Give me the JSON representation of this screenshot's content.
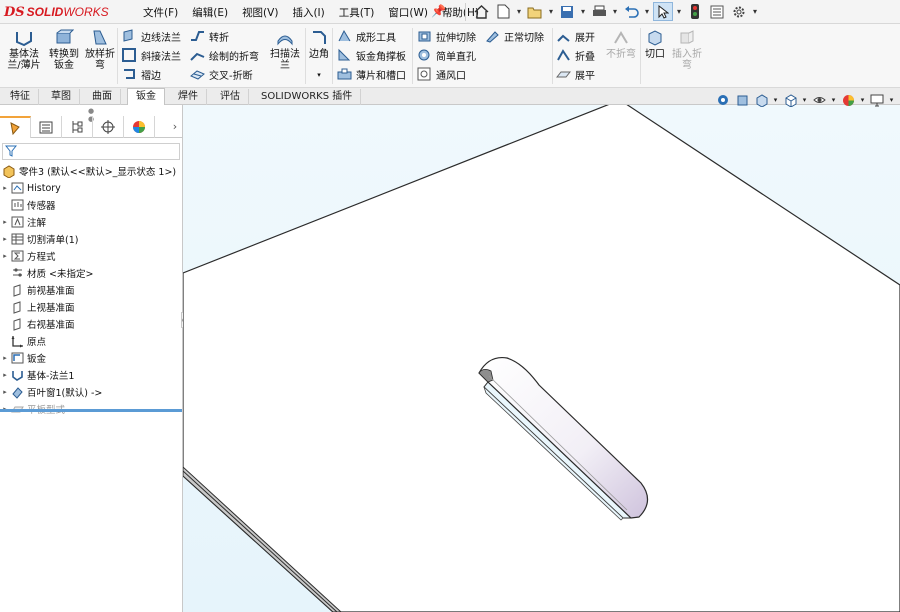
{
  "app": {
    "brand_ds": "DS",
    "brand_solid": "SOLID",
    "brand_works": "WORKS"
  },
  "menu": [
    "文件(F)",
    "编辑(E)",
    "视图(V)",
    "插入(I)",
    "工具(T)",
    "窗口(W)",
    "帮助(H)"
  ],
  "quick_access": [
    "home-icon",
    "new-icon",
    "open-icon",
    "save-icon",
    "print-icon",
    "undo-icon",
    "select-icon",
    "traffic-light-icon",
    "options-icon",
    "settings-icon"
  ],
  "ribbon": {
    "big": [
      {
        "label": "基体法\n兰/薄片",
        "icon": "base-flange-icon"
      },
      {
        "label": "转换到\n钣金",
        "icon": "convert-sheetmetal-icon"
      },
      {
        "label": "放样折\n弯",
        "icon": "lofted-bend-icon"
      }
    ],
    "col1": [
      "边线法兰",
      "斜接法兰",
      "褶边"
    ],
    "col2": [
      "转折",
      "绘制的折弯",
      "交叉-折断"
    ],
    "sweep": "扫描法\n兰",
    "corner": "边角",
    "col3": [
      "成形工具",
      "钣金角撑板",
      "薄片和槽口"
    ],
    "col4": [
      "拉伸切除",
      "简单直孔",
      "通风口"
    ],
    "normal_cut": "正常切除",
    "col5": [
      "展开",
      "折叠",
      "展平"
    ],
    "no_bend": "不折弯",
    "rip": "切口",
    "insert_bend": "插入折\n弯"
  },
  "tabs": [
    "特征",
    "草图",
    "曲面",
    "钣金",
    "焊件",
    "评估",
    "SOLIDWORKS 插件"
  ],
  "active_tab": "钣金",
  "tree": {
    "root": "零件3 (默认<<默认>_显示状态 1>)",
    "items": [
      {
        "label": "History",
        "expandable": true,
        "icon": "history-icon"
      },
      {
        "label": "传感器",
        "expandable": false,
        "icon": "sensor-icon"
      },
      {
        "label": "注解",
        "expandable": true,
        "icon": "annotation-icon"
      },
      {
        "label": "切割清单(1)",
        "expandable": true,
        "icon": "cut-list-icon"
      },
      {
        "label": "方程式",
        "expandable": true,
        "icon": "equation-icon"
      },
      {
        "label": "材质 <未指定>",
        "expandable": false,
        "icon": "material-icon"
      },
      {
        "label": "前视基准面",
        "expandable": false,
        "icon": "plane-icon"
      },
      {
        "label": "上视基准面",
        "expandable": false,
        "icon": "plane-icon"
      },
      {
        "label": "右视基准面",
        "expandable": false,
        "icon": "plane-icon"
      },
      {
        "label": "原点",
        "expandable": false,
        "icon": "origin-icon"
      },
      {
        "label": "钣金",
        "expandable": true,
        "icon": "sheetmetal-icon"
      },
      {
        "label": "基体-法兰1",
        "expandable": true,
        "icon": "base-flange-feature-icon"
      },
      {
        "label": "百叶窗1(默认) ->",
        "expandable": true,
        "icon": "louver-icon"
      },
      {
        "label": "平板型式",
        "expandable": true,
        "icon": "flat-pattern-icon",
        "suppressed": true
      }
    ]
  },
  "colors": {
    "accent": "#2a6fb5",
    "brand": "#d71920",
    "viewport_bg": "#e9f6fc",
    "splitter": "#5b9bd5"
  }
}
